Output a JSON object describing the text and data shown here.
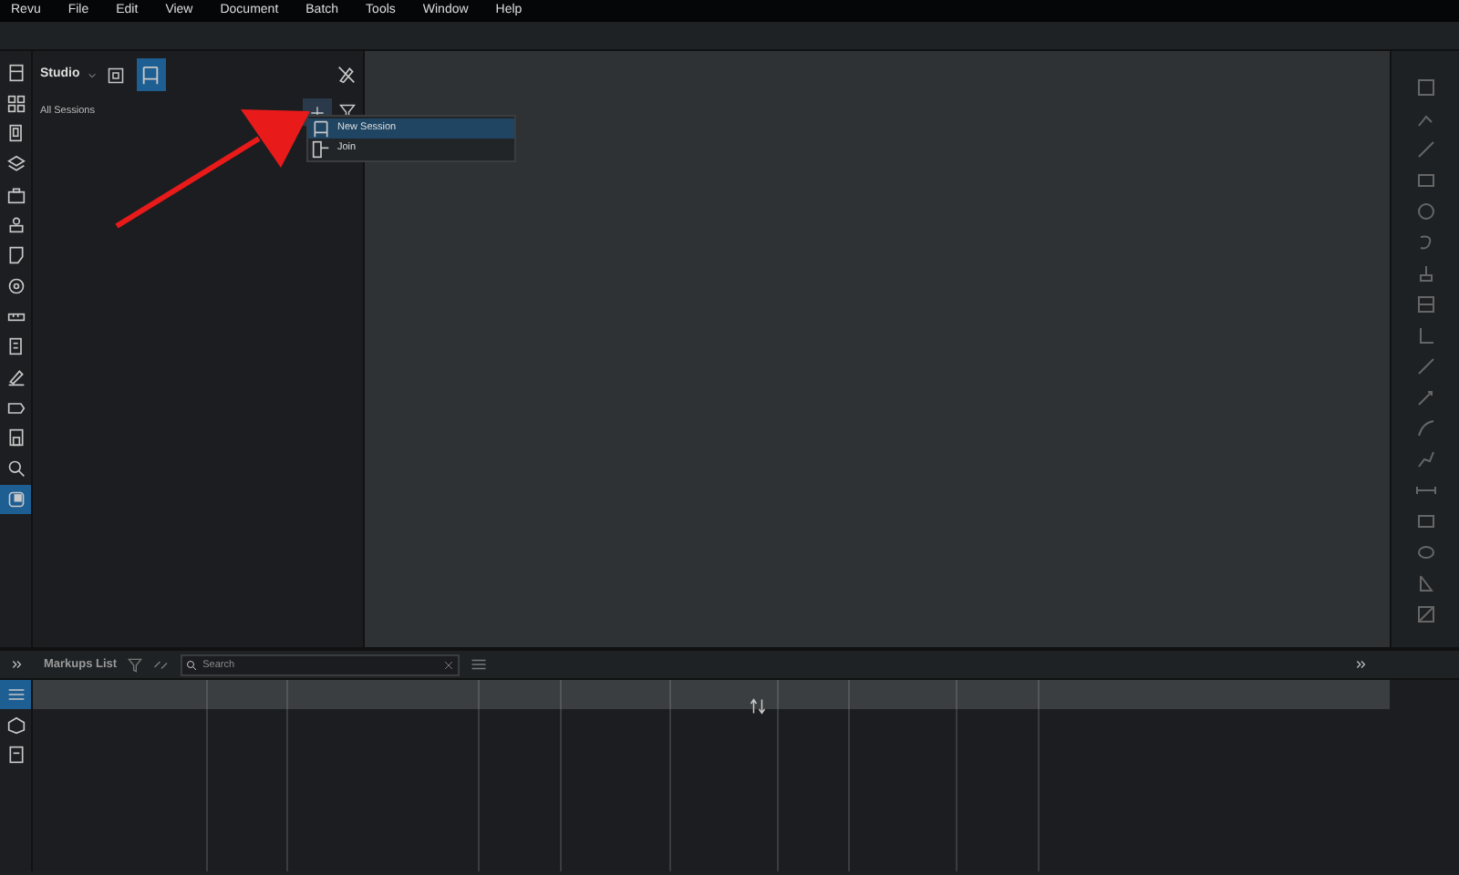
{
  "menu_bar": [
    "Revu",
    "File",
    "Edit",
    "View",
    "Document",
    "Batch",
    "Tools",
    "Window",
    "Help"
  ],
  "left_tools": [
    {
      "selected": false
    },
    {
      "selected": false
    },
    {
      "selected": false
    },
    {
      "selected": false
    },
    {
      "selected": false
    },
    {
      "selected": false
    },
    {
      "selected": false
    },
    {
      "selected": false
    },
    {
      "selected": false
    },
    {
      "selected": false
    },
    {
      "selected": false
    },
    {
      "selected": false
    },
    {
      "selected": false
    },
    {
      "selected": false
    },
    {
      "selected": true
    }
  ],
  "panel": {
    "title": "Studio",
    "subtitle": "All Sessions",
    "view_modes": [
      {
        "selected": false
      },
      {
        "selected": true
      }
    ]
  },
  "dropdown": [
    {
      "label": "New Session",
      "selected": true
    },
    {
      "label": "Join",
      "selected": false
    }
  ],
  "bottom_panel": {
    "title": "Markups List",
    "search": {
      "placeholder": "Search"
    },
    "side_tabs": [
      {
        "selected": true
      },
      {
        "selected": false
      },
      {
        "selected": false
      }
    ]
  }
}
